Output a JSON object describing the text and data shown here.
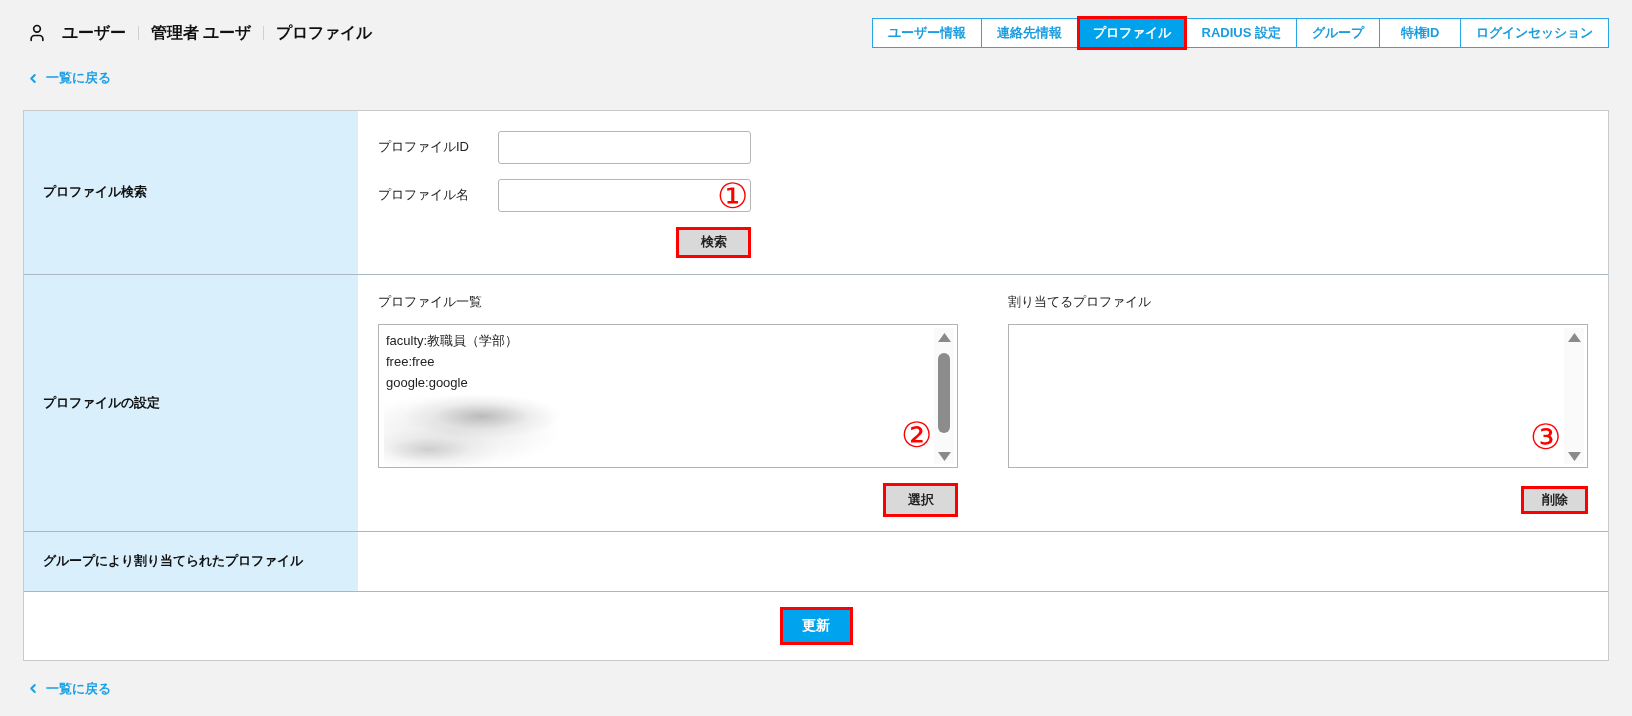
{
  "header": {
    "breadcrumb": [
      "ユーザー",
      "管理者 ユーザ",
      "プロファイル"
    ]
  },
  "tabs": [
    {
      "label": "ユーザー情報",
      "selected": false,
      "highlighted": false
    },
    {
      "label": "連絡先情報",
      "selected": false,
      "highlighted": false
    },
    {
      "label": "プロファイル",
      "selected": true,
      "highlighted": true
    },
    {
      "label": "RADIUS 設定",
      "selected": false,
      "highlighted": false
    },
    {
      "label": "グループ",
      "selected": false,
      "highlighted": false
    },
    {
      "label": "特権ID",
      "selected": false,
      "highlighted": false
    },
    {
      "label": "ログインセッション",
      "selected": false,
      "highlighted": false
    }
  ],
  "back_link_top": "一覧に戻る",
  "search_section": {
    "label": "プロファイル検索",
    "fields": [
      {
        "label": "プロファイルID"
      },
      {
        "label": "プロファイル名",
        "callout": "①"
      }
    ],
    "button": {
      "label": "検索",
      "highlighted": true
    }
  },
  "settings_section": {
    "label": "プロファイルの設定",
    "lists": [
      {
        "title": "プロファイル一覧",
        "items": [
          {
            "label": "faculty:教職員（学部）",
            "selected": false
          },
          {
            "label": "free:free",
            "selected": false
          },
          {
            "label": "google:google",
            "selected": false
          }
        ],
        "blurred": true,
        "callout": "②",
        "button": {
          "label": "選択",
          "highlighted": true
        }
      },
      {
        "title": "割り当てるプロファイル",
        "callout": "③",
        "button": {
          "label": "削除",
          "highlighted": true
        }
      }
    ]
  },
  "group_section": {
    "label": "グループにより割り当てられたプロファイル"
  },
  "update_button": {
    "label": "更新",
    "highlighted": true
  },
  "back_link_bottom": "一覧に戻る"
}
